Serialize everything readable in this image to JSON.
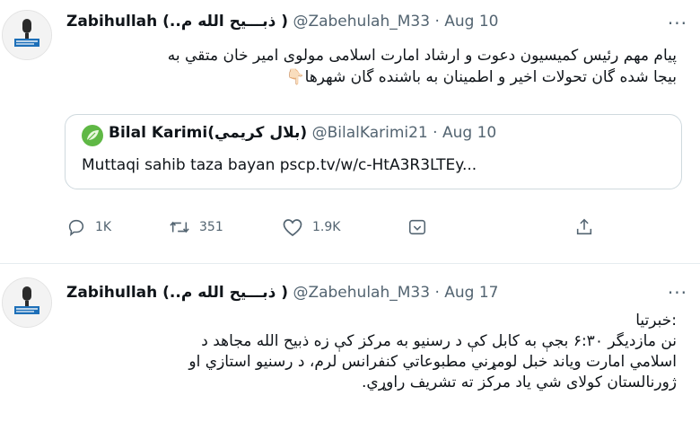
{
  "tweets": [
    {
      "name": "Zabihullah (..ذبـــیح الله م )",
      "handle": "@Zabehulah_M33",
      "separator": "·",
      "date": "Aug 10",
      "more": "···",
      "text_lines": [
        "پیام مهم رئیس کمیسیون دعوت و ارشاد امارت اسلامی مولوی امیر خان متقي به",
        "بیجا شده گان تحولات اخیر و اطمینان به باشنده گان شهرها👇🏻"
      ],
      "quote": {
        "name": "Bilal Karimi(بلال كريمي)",
        "handle": "@BilalKarimi21",
        "separator": "·",
        "date": "Aug 10",
        "text": "Muttaqi sahib taza bayan pscp.tv/w/c-HtA3R3LTEy..."
      },
      "stats": {
        "replies": "1K",
        "retweets": "351",
        "likes": "1.9K"
      },
      "icons": [
        "reply-icon",
        "retweet-icon",
        "like-icon",
        "views-icon",
        "share-icon"
      ]
    },
    {
      "name": "Zabihullah (..ذبـــیح الله م )",
      "handle": "@Zabehulah_M33",
      "separator": "·",
      "date": "Aug 17",
      "more": "···",
      "text_lines": [
        ":خبرتیا",
        "نن مازدیگر ۶:۳۰ بجې به کابل کې د رسنیو به مرکز کې زه ذبیح الله مجاهد د",
        "اسلامي امارت وياند خبل لومړني مطبوعاتي کنفرانس لرم، د رسنیو استازي او",
        "ژورنالستان کولای شي یاد مرکز ته تشریف راوړي."
      ]
    }
  ],
  "colors": {
    "accent": "#1d9bf0",
    "muted": "#536471",
    "border": "#cfd9de",
    "verified_green": "#5fb845"
  }
}
